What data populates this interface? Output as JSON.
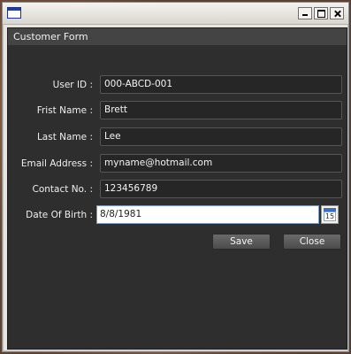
{
  "window": {
    "title": ""
  },
  "form": {
    "title": "Customer Form",
    "fields": [
      {
        "label": "User ID :",
        "value": "000-ABCD-001"
      },
      {
        "label": "Frist Name :",
        "value": "Brett"
      },
      {
        "label": "Last Name :",
        "value": "Lee"
      },
      {
        "label": "Email Address :",
        "value": "myname@hotmail.com"
      },
      {
        "label": "Contact No. :",
        "value": "123456789"
      }
    ],
    "dob": {
      "label": "Date Of Birth :",
      "value": "8/8/1981",
      "calendar_day": "15"
    },
    "buttons": {
      "save": "Save",
      "close": "Close"
    }
  },
  "colors": {
    "form_background": "#2e2e2e",
    "header_background": "#444444",
    "field_background": "#262626",
    "text": "#efefef"
  }
}
